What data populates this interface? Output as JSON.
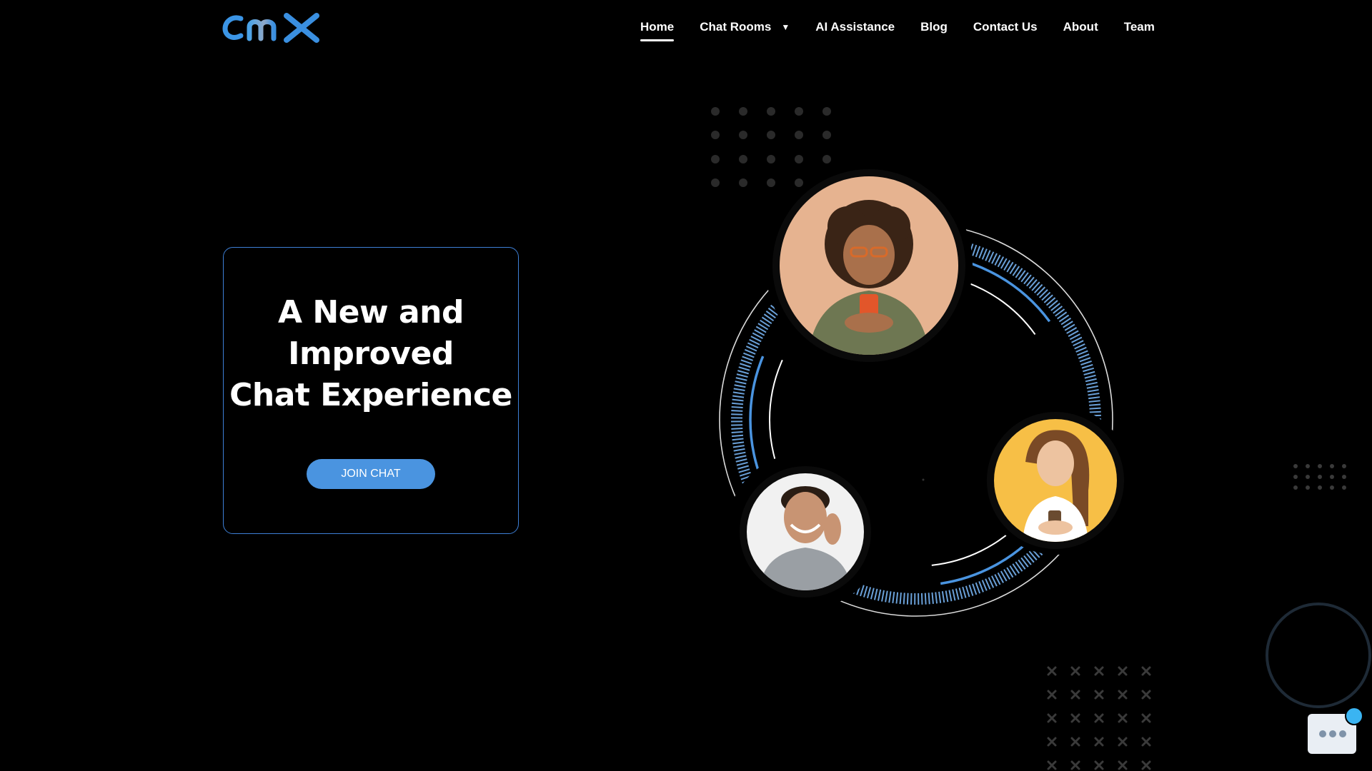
{
  "brand": {
    "logo_text": "cmx",
    "accent": "#3d7fd6",
    "button_color": "#4a94e0"
  },
  "nav": {
    "items": [
      {
        "label": "Home",
        "active": true
      },
      {
        "label": "Chat Rooms",
        "dropdown": true
      },
      {
        "label": "AI Assistance"
      },
      {
        "label": "Blog"
      },
      {
        "label": "Contact Us"
      },
      {
        "label": "About"
      },
      {
        "label": "Team"
      }
    ]
  },
  "hero": {
    "title_lines": [
      "A New and",
      "Improved",
      "Chat Experience"
    ],
    "cta_label": "JOIN CHAT"
  },
  "illustration": {
    "people": [
      "woman-with-phone-avatar",
      "man-on-phone-avatar",
      "woman-smiling-avatar"
    ]
  },
  "chat_widget": {
    "icon": "chat-bubble-icon",
    "badge_color": "#3ab4f2"
  }
}
